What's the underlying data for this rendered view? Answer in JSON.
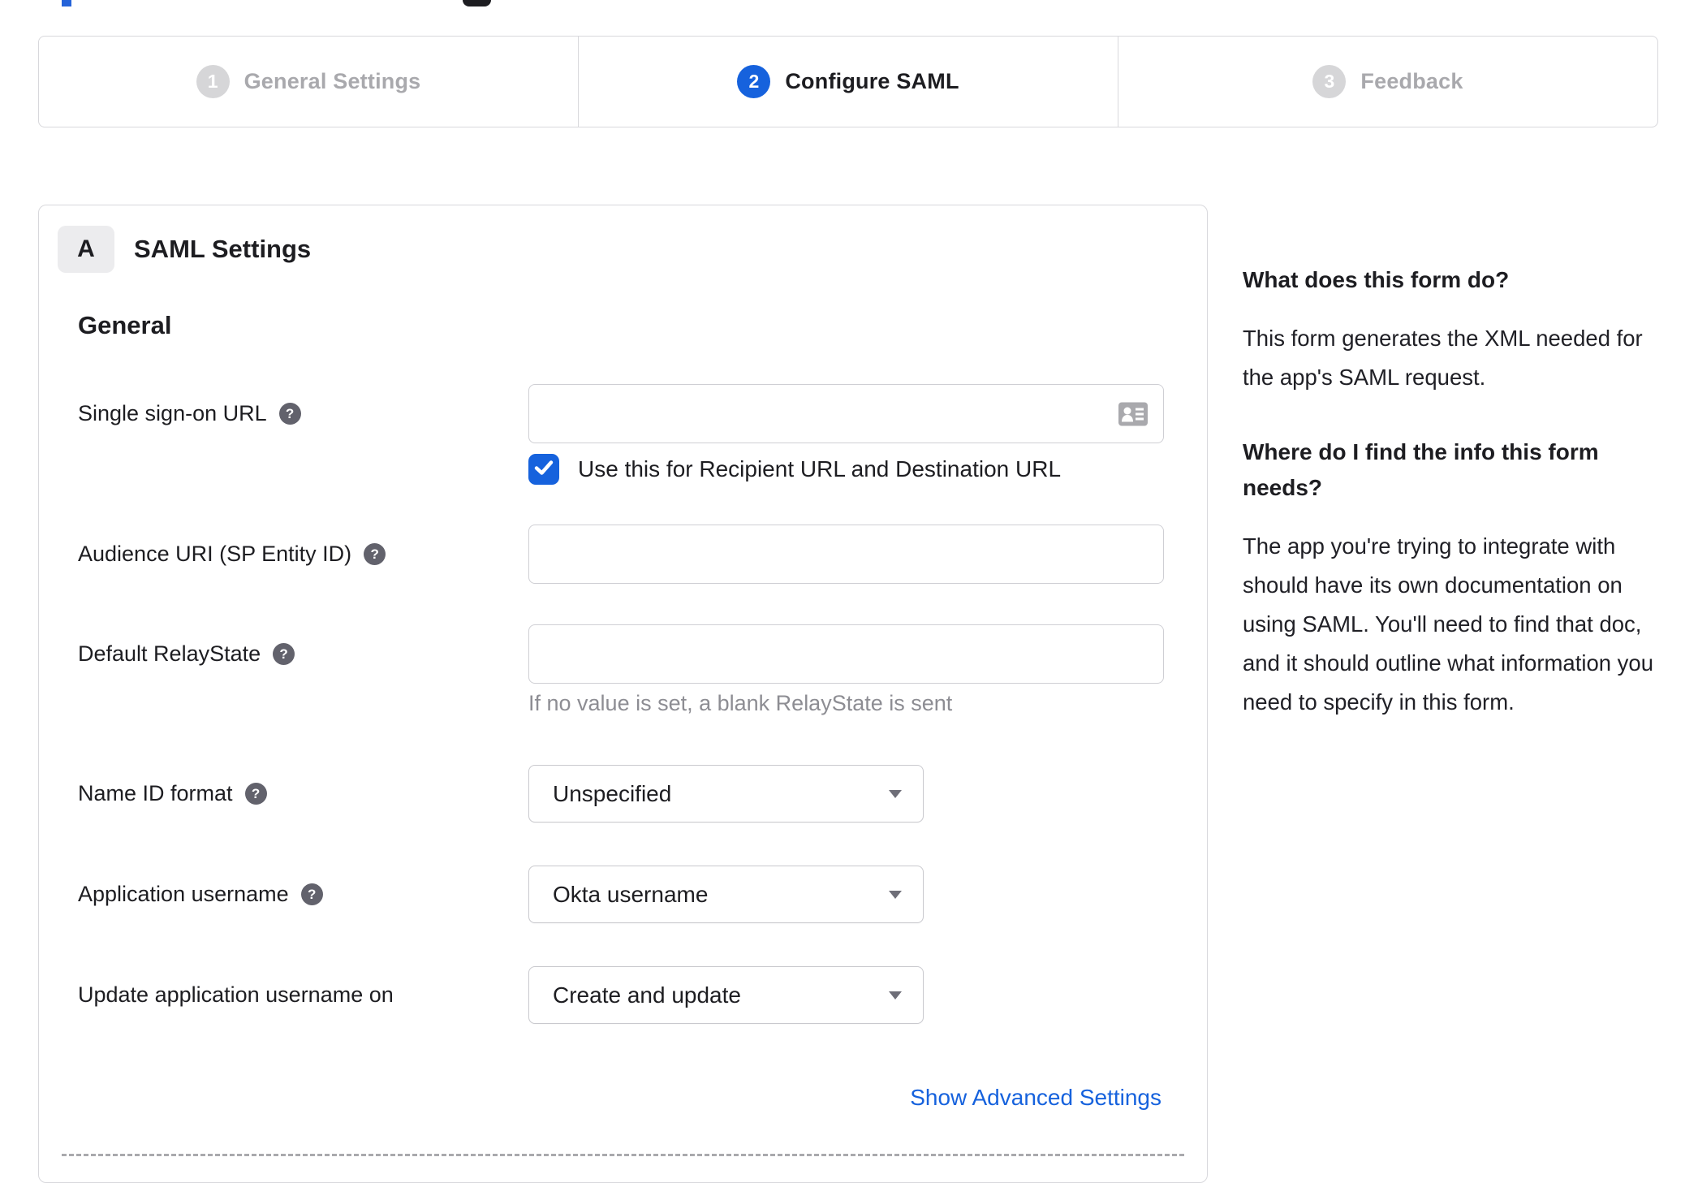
{
  "stepper": {
    "steps": [
      {
        "number": "1",
        "label": "General Settings",
        "state": "inactive"
      },
      {
        "number": "2",
        "label": "Configure SAML",
        "state": "active"
      },
      {
        "number": "3",
        "label": "Feedback",
        "state": "inactive"
      }
    ]
  },
  "panel": {
    "section_badge": "A",
    "title": "SAML Settings",
    "general_heading": "General",
    "sso": {
      "label": "Single sign-on URL",
      "value": "",
      "checkbox_label": "Use this for Recipient URL and Destination URL",
      "checked": true
    },
    "audience": {
      "label": "Audience URI (SP Entity ID)",
      "value": ""
    },
    "relay": {
      "label": "Default RelayState",
      "value": "",
      "helper": "If no value is set, a blank RelayState is sent"
    },
    "name_id": {
      "label": "Name ID format",
      "value": "Unspecified"
    },
    "app_username": {
      "label": "Application username",
      "value": "Okta username"
    },
    "update_username": {
      "label": "Update application username on",
      "value": "Create and update"
    },
    "advanced_link": "Show Advanced Settings"
  },
  "help_panel": {
    "q1": "What does this form do?",
    "a1": "This form generates the XML needed for the app's SAML request.",
    "q2": "Where do I find the info this form needs?",
    "a2": "The app you're trying to integrate with should have its own documentation on using SAML. You'll need to find that doc, and it should outline what information you need to specify in this form."
  },
  "colors": {
    "accent_blue": "#1662dd",
    "inactive_gray": "#a9a9ad",
    "border_gray": "#d8d8dc"
  },
  "icons": {
    "help": "question-mark",
    "checkbox": "checkmark",
    "sso_input": "contact-card",
    "select": "caret-down"
  }
}
